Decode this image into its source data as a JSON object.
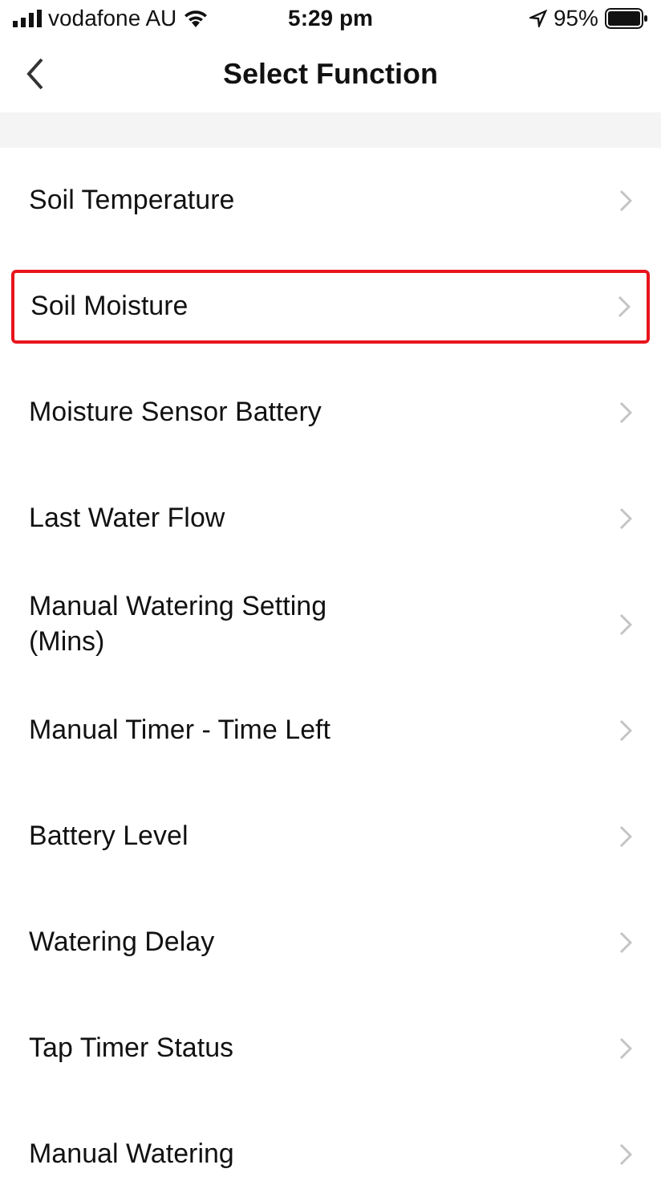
{
  "status_bar": {
    "carrier": "vodafone AU",
    "time": "5:29 pm",
    "battery": "95%"
  },
  "header": {
    "title": "Select Function"
  },
  "functions": [
    {
      "label": "Soil Temperature",
      "highlighted": false
    },
    {
      "label": "Soil Moisture",
      "highlighted": true
    },
    {
      "label": "Moisture Sensor Battery",
      "highlighted": false
    },
    {
      "label": "Last Water Flow",
      "highlighted": false
    },
    {
      "label": "Manual Watering Setting (Mins)",
      "highlighted": false
    },
    {
      "label": "Manual Timer - Time Left",
      "highlighted": false
    },
    {
      "label": "Battery Level",
      "highlighted": false
    },
    {
      "label": "Watering Delay",
      "highlighted": false
    },
    {
      "label": "Tap Timer Status",
      "highlighted": false
    },
    {
      "label": "Manual Watering",
      "highlighted": false
    }
  ]
}
